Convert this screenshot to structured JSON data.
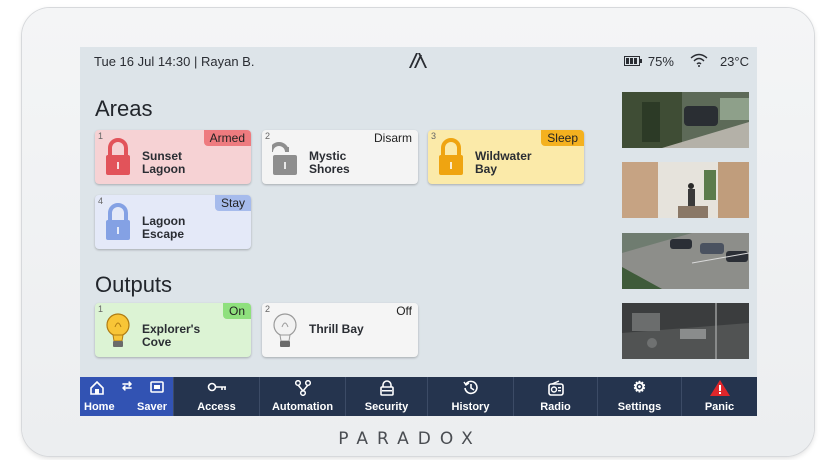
{
  "status": {
    "datetime_user": "Tue 16 Jul 14:30 | Rayan B.",
    "battery": "75%",
    "temperature": "23°C"
  },
  "areas": {
    "title": "Areas",
    "items": [
      {
        "num": "1",
        "name": "Sunset\nLagoon",
        "status": "Armed",
        "color": "#f6d2d4",
        "badge_color": "#ee7b7f",
        "icon_color": "#e2535a"
      },
      {
        "num": "2",
        "name": "Mystic\nShores",
        "status": "Disarm",
        "color": "#f4f4f4",
        "badge_color": "#f4f4f4",
        "icon_color": "#8e8e8e"
      },
      {
        "num": "3",
        "name": "Wildwater\nBay",
        "status": "Sleep",
        "color": "#fbeaa9",
        "badge_color": "#f4b11f",
        "icon_color": "#efa411"
      },
      {
        "num": "4",
        "name": "Lagoon\nEscape",
        "status": "Stay",
        "color": "#e4e9f8",
        "badge_color": "#a6bbec",
        "icon_color": "#84a1e4"
      }
    ]
  },
  "outputs": {
    "title": "Outputs",
    "items": [
      {
        "num": "1",
        "name": "Explorer's\nCove",
        "status": "On",
        "color": "#dcf3d4",
        "badge_color": "#8fe07d",
        "icon": "bulb-on"
      },
      {
        "num": "2",
        "name": "Thrill Bay",
        "status": "Off",
        "color": "#f5f5f5",
        "badge_color": "#f5f5f5",
        "icon": "bulb-off"
      }
    ]
  },
  "navbar": {
    "home": "Home",
    "saver": "Saver",
    "access": "Access",
    "automation": "Automation",
    "security": "Security",
    "history": "History",
    "radio": "Radio",
    "settings": "Settings",
    "panic": "Panic"
  },
  "brand": "PARADOX",
  "accent": "#3253b3"
}
